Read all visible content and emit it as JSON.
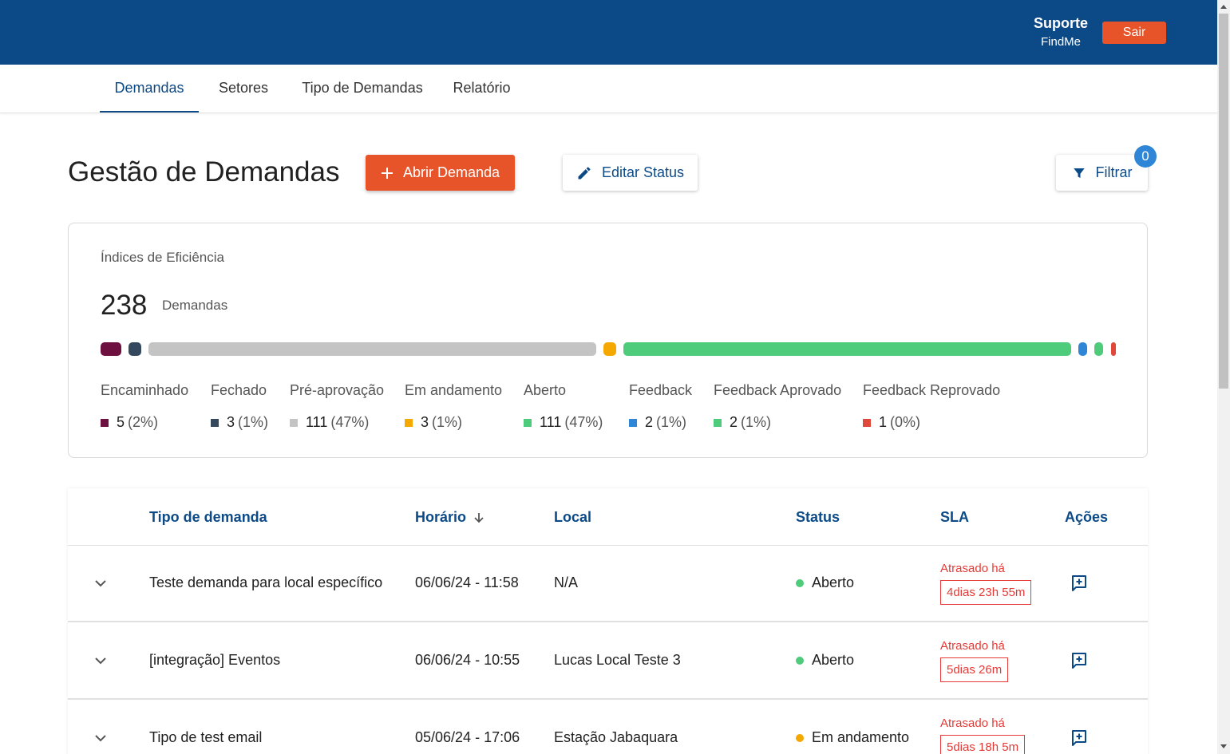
{
  "header": {
    "user_name": "Suporte",
    "user_org": "FindMe",
    "logout_label": "Sair",
    "background_color": "#0c4a87",
    "accent_color": "#e8542a"
  },
  "nav": {
    "tabs": [
      {
        "label": "Demandas",
        "active": true
      },
      {
        "label": "Setores",
        "active": false
      },
      {
        "label": "Tipo de Demandas",
        "active": false
      },
      {
        "label": "Relatório",
        "active": false
      }
    ]
  },
  "page": {
    "title": "Gestão de Demandas",
    "open_demand_label": "Abrir Demanda",
    "edit_status_label": "Editar Status",
    "filter_label": "Filtrar",
    "filter_count": "0"
  },
  "efficiency": {
    "title": "Índices de Eficiência",
    "total": "238",
    "total_label": "Demandas",
    "statuses": [
      {
        "name": "Encaminhado",
        "count": "5",
        "percent": "(2%)",
        "color": "#6d0f3f"
      },
      {
        "name": "Fechado",
        "count": "3",
        "percent": "(1%)",
        "color": "#34495e"
      },
      {
        "name": "Pré-aprovação",
        "count": "111",
        "percent": "(47%)",
        "color": "#c4c4c4"
      },
      {
        "name": "Em andamento",
        "count": "3",
        "percent": "(1%)",
        "color": "#f5a800"
      },
      {
        "name": "Aberto",
        "count": "111",
        "percent": "(47%)",
        "color": "#4ecb7b"
      },
      {
        "name": "Feedback",
        "count": "2",
        "percent": "(1%)",
        "color": "#2f86d6"
      },
      {
        "name": "Feedback Aprovado",
        "count": "2",
        "percent": "(1%)",
        "color": "#4ecb7b"
      },
      {
        "name": "Feedback Reprovado",
        "count": "1",
        "percent": "(0%)",
        "color": "#e0483a"
      }
    ]
  },
  "table": {
    "columns": {
      "type": "Tipo de demanda",
      "time": "Horário",
      "location": "Local",
      "status": "Status",
      "sla": "SLA",
      "actions": "Ações"
    },
    "sort_icon": "arrow-down-icon",
    "rows": [
      {
        "type": "Teste demanda para local específico",
        "time": "06/06/24 - 11:58",
        "location": "N/A",
        "status": "Aberto",
        "status_color": "#4ecb7b",
        "sla_label": "Atrasado há",
        "sla_value": "4dias 23h 55m"
      },
      {
        "type": "[integração] Eventos",
        "time": "06/06/24 - 10:55",
        "location": "Lucas Local Teste 3",
        "status": "Aberto",
        "status_color": "#4ecb7b",
        "sla_label": "Atrasado há",
        "sla_value": "5dias 26m"
      },
      {
        "type": "Tipo de test email",
        "time": "05/06/24 - 17:06",
        "location": "Estação Jabaquara",
        "status": "Em andamento",
        "status_color": "#f5a800",
        "sla_label": "Atrasado há",
        "sla_value": "5dias 18h 5m"
      }
    ]
  }
}
